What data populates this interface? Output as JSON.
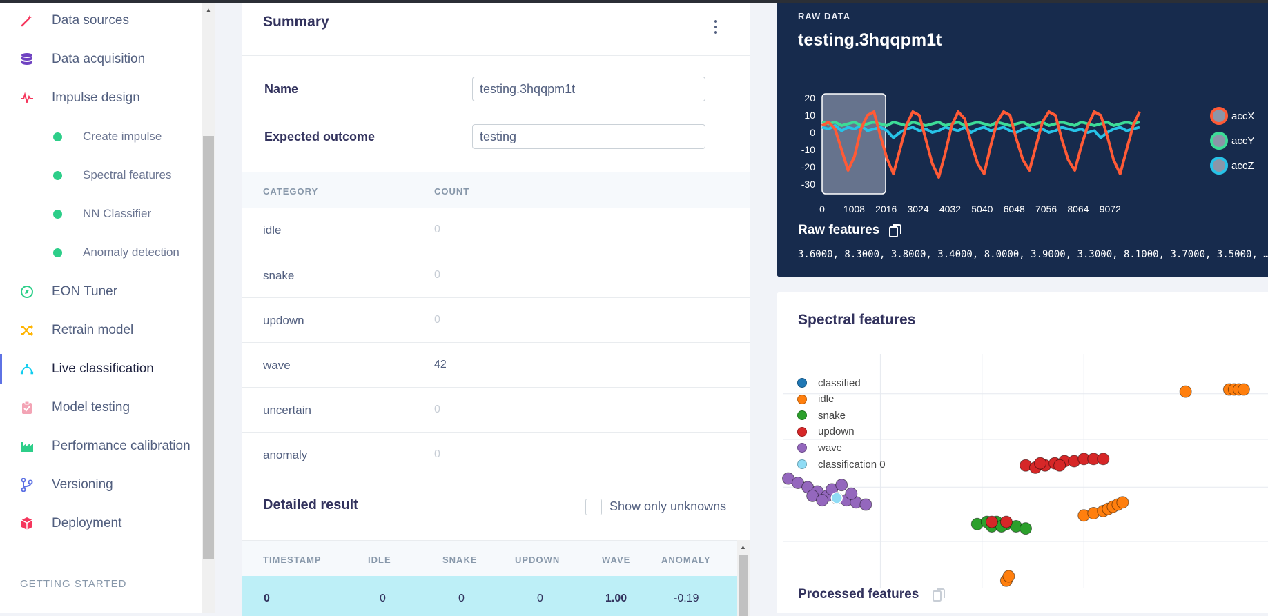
{
  "sidebar": {
    "items": [
      {
        "label": "Data sources",
        "icon": "magic-wand-icon",
        "color": "#f5365c"
      },
      {
        "label": "Data acquisition",
        "icon": "database-icon",
        "color": "#6f42c1"
      },
      {
        "label": "Impulse design",
        "icon": "pulse-icon",
        "color": "#f5365c"
      },
      {
        "label": "EON Tuner",
        "icon": "compass-icon",
        "color": "#2dce89"
      },
      {
        "label": "Retrain model",
        "icon": "shuffle-icon",
        "color": "#ffb400"
      },
      {
        "label": "Live classification",
        "icon": "bezier-icon",
        "color": "#11cdef",
        "active": true
      },
      {
        "label": "Model testing",
        "icon": "clipboard-check-icon",
        "color": "#f3a4b5"
      },
      {
        "label": "Performance calibration",
        "icon": "factory-icon",
        "color": "#2dce89"
      },
      {
        "label": "Versioning",
        "icon": "git-branch-icon",
        "color": "#5e72e4"
      },
      {
        "label": "Deployment",
        "icon": "cube-icon",
        "color": "#f5365c"
      }
    ],
    "sub_items": [
      {
        "label": "Create impulse"
      },
      {
        "label": "Spectral features"
      },
      {
        "label": "NN Classifier"
      },
      {
        "label": "Anomaly detection"
      }
    ],
    "section_title": "GETTING STARTED"
  },
  "summary": {
    "title": "Summary",
    "name_label": "Name",
    "name_value": "testing.3hqqpm1t",
    "expected_label": "Expected outcome",
    "expected_value": "testing",
    "col_category": "CATEGORY",
    "col_count": "COUNT",
    "categories": [
      {
        "name": "idle",
        "count": "0"
      },
      {
        "name": "snake",
        "count": "0"
      },
      {
        "name": "updown",
        "count": "0"
      },
      {
        "name": "wave",
        "count": "42"
      },
      {
        "name": "uncertain",
        "count": "0"
      },
      {
        "name": "anomaly",
        "count": "0"
      }
    ],
    "detailed_title": "Detailed result",
    "show_unknowns_label": "Show only unknowns",
    "result_columns": [
      "TIMESTAMP",
      "IDLE",
      "SNAKE",
      "UPDOWN",
      "WAVE",
      "ANOMALY"
    ],
    "result_row": [
      "0",
      "0",
      "0",
      "0",
      "1.00",
      "-0.19"
    ]
  },
  "raw": {
    "eyebrow": "RAW DATA",
    "title": "testing.3hqqpm1t",
    "features_label": "Raw features",
    "features_value": "3.6000, 8.3000, 3.8000, 3.4000, 8.0000, 3.9000, 3.3000, 8.1000, 3.7000, 3.5000, …"
  },
  "spectral": {
    "title": "Spectral features",
    "processed_label": "Processed features"
  },
  "chart_data": [
    {
      "type": "line",
      "x_ticks": [
        "0",
        "1008",
        "2016",
        "3024",
        "4032",
        "5040",
        "6048",
        "7056",
        "8064",
        "9072"
      ],
      "y_ticks": [
        "20",
        "10",
        "0",
        "-10",
        "-20",
        "-30"
      ],
      "ylim": [
        -30,
        20
      ],
      "xlim": [
        0,
        10000
      ],
      "window": [
        0,
        2000
      ],
      "legend": [
        "accX",
        "accY",
        "accZ"
      ],
      "colors": {
        "accX": "#ff5a36",
        "accY": "#3ddc97",
        "accZ": "#27c3e8"
      },
      "series": [
        {
          "name": "accX",
          "values": [
            4,
            6,
            2,
            -10,
            -22,
            -14,
            2,
            10,
            12,
            -2,
            -15,
            -24,
            -10,
            4,
            12,
            10,
            -4,
            -18,
            -26,
            -12,
            4,
            12,
            8,
            -6,
            -18,
            -24,
            -8,
            6,
            12,
            10,
            -4,
            -16,
            -22,
            -8,
            6,
            12,
            10,
            -4,
            -16,
            -22,
            -8,
            4,
            12,
            10,
            -2,
            -16,
            -24,
            -10,
            4,
            12
          ]
        },
        {
          "name": "accY",
          "values": [
            6,
            5,
            6,
            4,
            5,
            6,
            4,
            5,
            6,
            5,
            4,
            6,
            5,
            4,
            6,
            5,
            4,
            5,
            6,
            4,
            5,
            6,
            4,
            5,
            6,
            5,
            4,
            6,
            5,
            4,
            5,
            6,
            4,
            5,
            6,
            4,
            5,
            6,
            5,
            4,
            6,
            5,
            4,
            5,
            6,
            4,
            5,
            6,
            5,
            6
          ]
        },
        {
          "name": "accZ",
          "values": [
            3,
            2,
            4,
            1,
            3,
            2,
            4,
            1,
            2,
            3,
            1,
            -3,
            0,
            2,
            3,
            1,
            2,
            0,
            1,
            3,
            2,
            1,
            3,
            0,
            2,
            3,
            1,
            2,
            3,
            1,
            0,
            2,
            3,
            1,
            2,
            0,
            1,
            3,
            2,
            1,
            2,
            0,
            1,
            -3,
            0,
            2,
            3,
            1,
            2,
            3
          ]
        }
      ]
    },
    {
      "type": "scatter",
      "legend": [
        "classified",
        "idle",
        "snake",
        "updown",
        "wave",
        "classification 0"
      ],
      "colors": {
        "classified": "#1f77b4",
        "idle": "#ff7f0e",
        "snake": "#2ca02c",
        "updown": "#d62728",
        "wave": "#9467bd",
        "classification 0": "#8fdcf5"
      },
      "xlim": [
        0,
        1
      ],
      "ylim": [
        0,
        1
      ],
      "series": [
        {
          "name": "idle",
          "points": [
            [
              0.83,
              0.89
            ],
            [
              0.92,
              0.9
            ],
            [
              0.93,
              0.9
            ],
            [
              0.94,
              0.9
            ],
            [
              0.95,
              0.9
            ],
            [
              0.62,
              0.32
            ],
            [
              0.64,
              0.33
            ],
            [
              0.66,
              0.34
            ],
            [
              0.67,
              0.35
            ],
            [
              0.68,
              0.36
            ],
            [
              0.69,
              0.37
            ],
            [
              0.7,
              0.38
            ],
            [
              0.46,
              0.02
            ],
            [
              0.465,
              0.04
            ]
          ]
        },
        {
          "name": "snake",
          "points": [
            [
              0.4,
              0.28
            ],
            [
              0.42,
              0.29
            ],
            [
              0.44,
              0.29
            ],
            [
              0.46,
              0.28
            ],
            [
              0.48,
              0.27
            ],
            [
              0.5,
              0.26
            ],
            [
              0.43,
              0.27
            ],
            [
              0.45,
              0.27
            ]
          ]
        },
        {
          "name": "updown",
          "points": [
            [
              0.5,
              0.55
            ],
            [
              0.52,
              0.54
            ],
            [
              0.54,
              0.55
            ],
            [
              0.56,
              0.56
            ],
            [
              0.58,
              0.57
            ],
            [
              0.6,
              0.57
            ],
            [
              0.62,
              0.58
            ],
            [
              0.64,
              0.58
            ],
            [
              0.66,
              0.58
            ],
            [
              0.53,
              0.56
            ],
            [
              0.57,
              0.55
            ],
            [
              0.43,
              0.29
            ],
            [
              0.46,
              0.29
            ]
          ]
        },
        {
          "name": "wave",
          "points": [
            [
              0.01,
              0.49
            ],
            [
              0.03,
              0.47
            ],
            [
              0.05,
              0.45
            ],
            [
              0.07,
              0.43
            ],
            [
              0.09,
              0.41
            ],
            [
              0.11,
              0.4
            ],
            [
              0.13,
              0.39
            ],
            [
              0.15,
              0.38
            ],
            [
              0.17,
              0.37
            ],
            [
              0.06,
              0.41
            ],
            [
              0.08,
              0.39
            ],
            [
              0.1,
              0.44
            ],
            [
              0.12,
              0.46
            ],
            [
              0.14,
              0.42
            ]
          ]
        },
        {
          "name": "classification 0",
          "points": [
            [
              0.11,
              0.4
            ]
          ]
        }
      ]
    }
  ]
}
